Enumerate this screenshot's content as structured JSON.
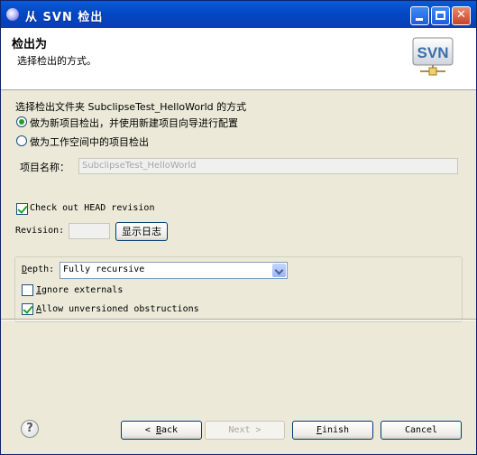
{
  "window": {
    "title": "从 SVN 检出",
    "minimize_label": "",
    "maximize_label": "",
    "close_label": "✕"
  },
  "header": {
    "title": "检出为",
    "description": "选择检出的方式。",
    "logo_text": "SVN"
  },
  "options": {
    "intro": "选择检出文件夹 SubclipseTest_HelloWorld 的方式",
    "radio_new_project": "做为新项目检出，并使用新建项目向导进行配置",
    "radio_workspace": "做为工作空间中的项目检出",
    "project_name_label": "项目名称：",
    "project_name_value": "SubclipseTest_HelloWorld"
  },
  "revision": {
    "head_checkbox_label": "Check out HEAD revision",
    "revision_label": "Revision:",
    "revision_value": "",
    "show_log_button": "显示日志"
  },
  "depth": {
    "label_first": "D",
    "label_rest": "epth:",
    "selected": "Fully recursive",
    "ignore_first": "I",
    "ignore_rest": "gnore externals",
    "allow_first": "A",
    "allow_rest": "llow unversioned obstructions"
  },
  "buttons": {
    "back_prefix": "< ",
    "back_first": "B",
    "back_rest": "ack",
    "next_label": "Next >",
    "finish_first": "F",
    "finish_rest": "inish",
    "cancel": "Cancel"
  },
  "help_icon_glyph": "?"
}
